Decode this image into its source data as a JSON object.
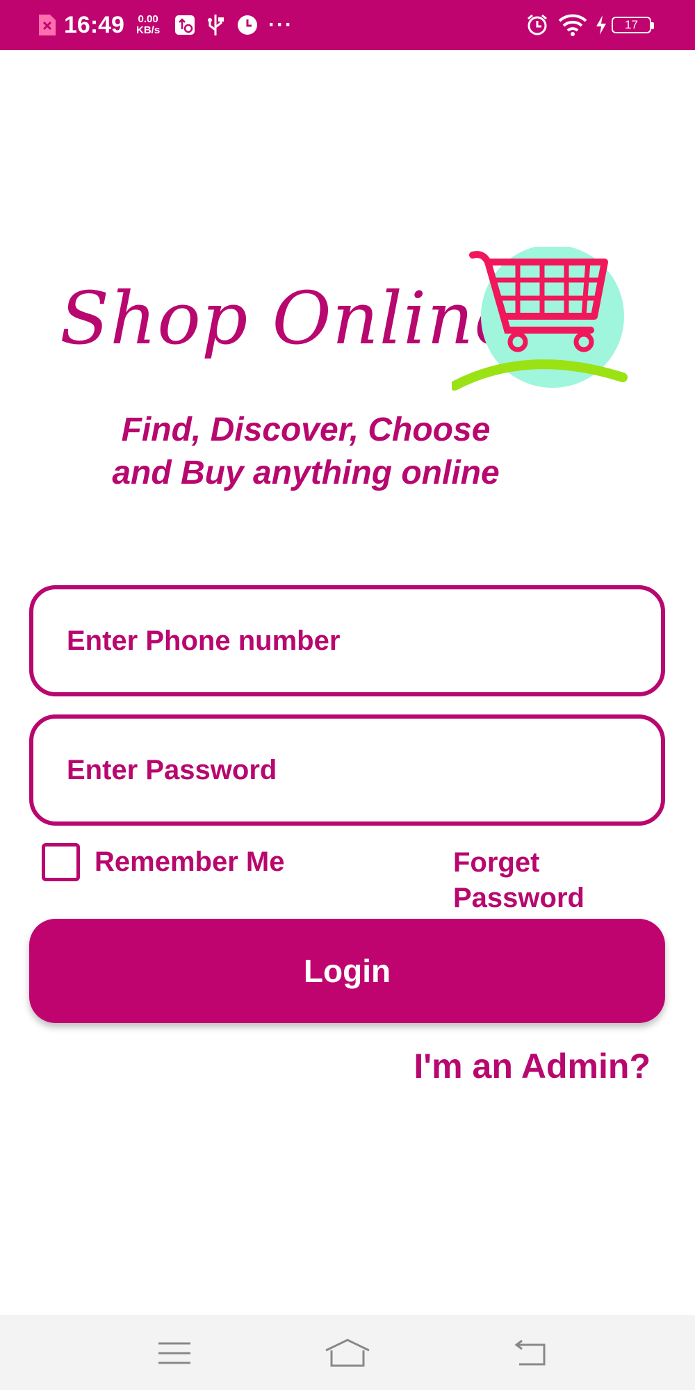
{
  "status_bar": {
    "time": "16:49",
    "net_speed_value": "0.00",
    "net_speed_unit": "KB/s",
    "battery": "17",
    "overflow": "···",
    "icons": [
      "sim-error-icon",
      "usb-settings-icon",
      "usb-icon",
      "alarm-icon",
      "alarm-icon",
      "wifi-icon",
      "charging-icon",
      "battery-icon"
    ]
  },
  "logo": {
    "text": "Shop Online",
    "icon": "shopping-cart-icon"
  },
  "tagline": {
    "line1": "Find, Discover, Choose",
    "line2": "and Buy anything online"
  },
  "form": {
    "phone_placeholder": "Enter Phone number",
    "password_placeholder": "Enter Password",
    "remember_label": "Remember Me",
    "remember_checked": false,
    "forget_line1": "Forget",
    "forget_line2": "Password",
    "login_label": "Login",
    "admin_link": "I'm an Admin?"
  },
  "nav_bar": {
    "icons": [
      "menu-icon",
      "home-icon",
      "back-icon"
    ]
  },
  "colors": {
    "brand": "#c0046f",
    "text": "#b8076f",
    "cart_circle": "#a0f5dd",
    "cart": "#f0175a",
    "swoosh": "#9ae214"
  }
}
